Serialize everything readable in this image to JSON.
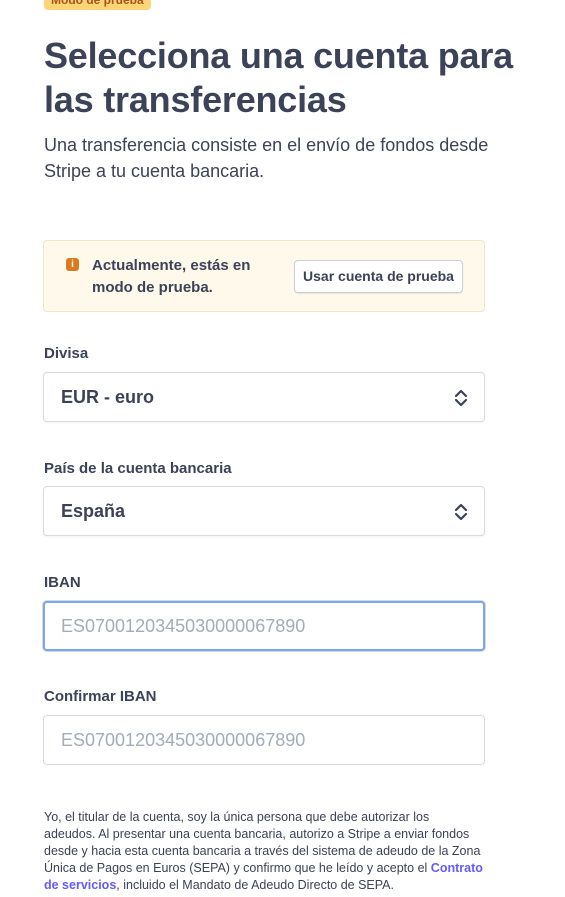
{
  "badge": {
    "text": "Modo de prueba"
  },
  "header": {
    "title": "Selecciona una cuenta para las transferencias",
    "subtitle": "Una transferencia consiste en el envío de fondos desde Stripe a tu cuenta bancaria."
  },
  "notice": {
    "icon": "info-icon",
    "text": "Actualmente, estás en modo de prueba.",
    "button_label": "Usar cuenta de prueba"
  },
  "form": {
    "currency": {
      "label": "Divisa",
      "value": "EUR - euro"
    },
    "country": {
      "label": "País de la cuenta bancaria",
      "value": "España"
    },
    "iban": {
      "label": "IBAN",
      "value": "",
      "placeholder": "ES0700120345030000067890"
    },
    "confirm_iban": {
      "label": "Confirmar IBAN",
      "value": "",
      "placeholder": "ES0700120345030000067890"
    }
  },
  "legal": {
    "text_before": "Yo, el titular de la cuenta, soy la única persona que debe autorizar los adeudos. Al presentar una cuenta bancaria, autorizo a Stripe a enviar fondos desde y hacia esta cuenta bancaria a través del sistema de adeudo de la Zona Única de Pagos en Euros (SEPA) y confirmo que he leído y acepto el ",
    "link_text": "Contrato de servicios",
    "text_after": ", incluido el Mandato de Adeudo Directo de SEPA."
  },
  "colors": {
    "badge_bg": "#fcd579",
    "notice_bg": "#fef9ea",
    "link": "#635bff",
    "focus": "#7ea6e0"
  }
}
